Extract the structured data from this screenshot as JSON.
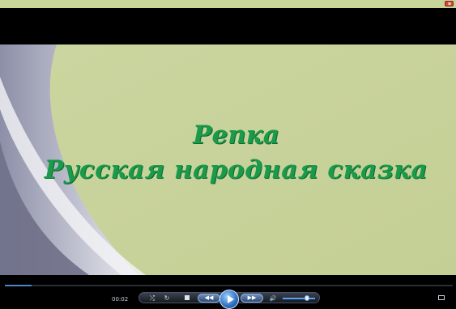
{
  "video": {
    "title_line_1": "Репка",
    "title_line_2": "Русская народная сказка"
  },
  "player": {
    "elapsed_time": "00:02",
    "seek_progress_percent": 6,
    "volume_percent": 75,
    "shuffle_icon": "⤮",
    "repeat_icon": "↻",
    "prev_icon": "◀◀",
    "next_icon": "▶▶",
    "volume_icon": "🔊",
    "colors": {
      "accent": "#2d6fc4",
      "title_green": "#1a9a4a",
      "background_green": "#c9d49c"
    }
  }
}
